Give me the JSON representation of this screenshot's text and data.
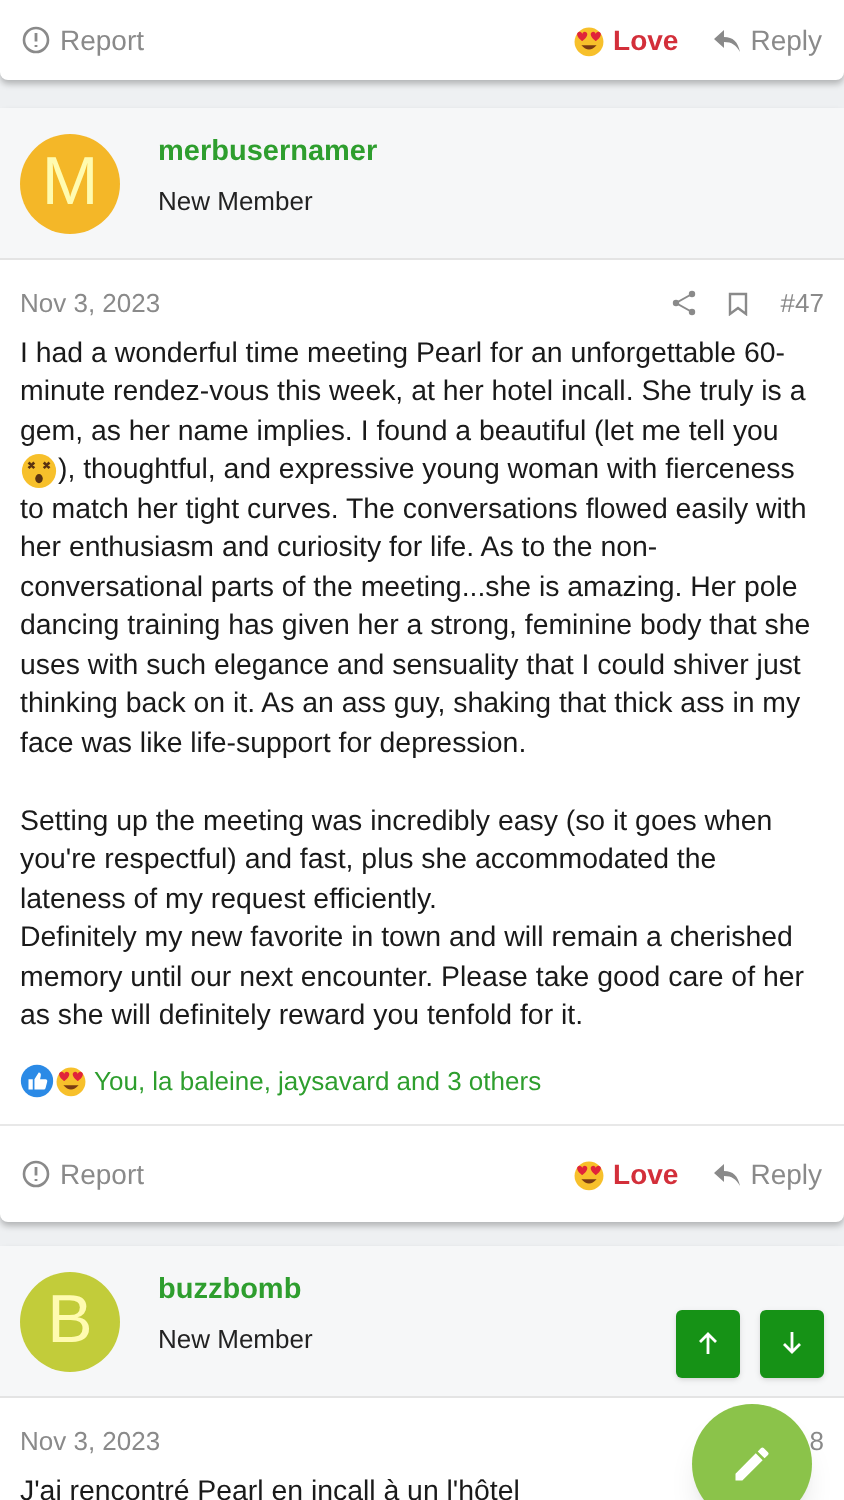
{
  "top_actions": {
    "report": "Report",
    "love": "Love",
    "reply": "Reply"
  },
  "posts": [
    {
      "avatar_letter": "M",
      "color": "#f4b728",
      "username": "merbusernamer",
      "role": "New Member",
      "date": "Nov 3, 2023",
      "number": "#47",
      "bookmark": true,
      "nav_buttons": false,
      "body": [
        {
          "kind": "emoji_text",
          "before": "I had a wonderful time meeting Pearl for an unforgettable 60-minute rendez-vous this week, at her hotel incall. She truly is a gem, as her name implies. I found a beautiful (let me tell you",
          "after_emoji": "), thoughtful, and expressive young woman with fierceness",
          "after": "to match her tight curves. The conversations flowed easily with her enthusiasm and curiosity for life. As to the non-conversational parts of the meeting...she is amazing. Her pole dancing training has given her a strong, feminine body that she uses with such elegance and sensuality that I could shiver just thinking back on it. As an ass guy, shaking that thick ass in my face was like life-support for depression."
        },
        {
          "kind": "text",
          "text": "Setting up the meeting was incredibly easy (so it goes when you're respectful) and fast, plus she accommodated the lateness of my request efficiently."
        },
        {
          "kind": "text",
          "text": "Definitely my new favorite in town and will remain a cherished memory until our next encounter. Please take good care of her as she will definitely reward you tenfold for it."
        }
      ],
      "reactions": "You, la baleine, jaysavard and 3 others",
      "actions": {
        "report": "Report",
        "love": "Love",
        "reply": "Reply"
      }
    },
    {
      "avatar_letter": "B",
      "color": "#c2cc3a",
      "username": "buzzbomb",
      "role": "New Member",
      "date": "Nov 3, 2023",
      "number": "8",
      "bookmark": false,
      "nav_buttons": true,
      "body": [
        {
          "kind": "text",
          "text": "J'ai rencontré Pearl en incall à un l'hôtel"
        }
      ]
    }
  ]
}
